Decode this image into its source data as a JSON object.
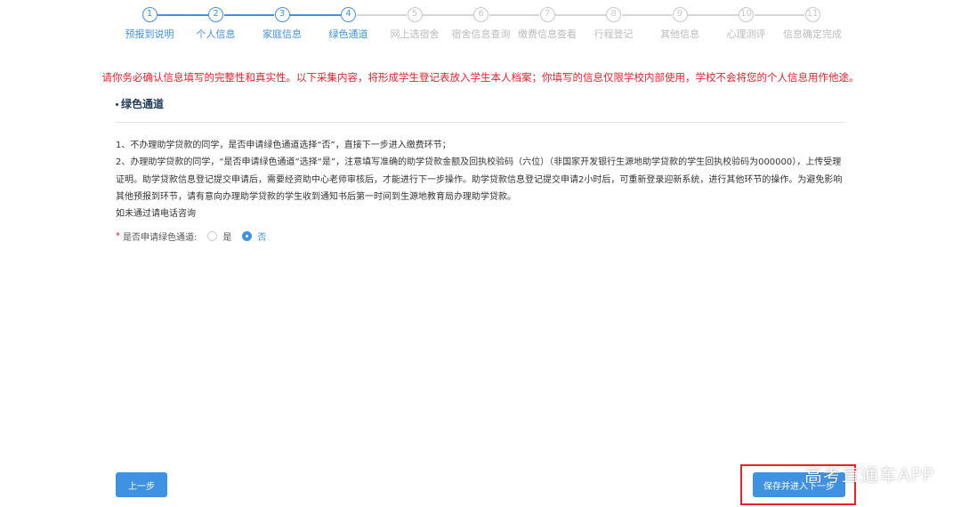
{
  "steps": [
    {
      "num": "1",
      "label": "预报到说明",
      "done": true
    },
    {
      "num": "2",
      "label": "个人信息",
      "done": true
    },
    {
      "num": "3",
      "label": "家庭信息",
      "done": true
    },
    {
      "num": "4",
      "label": "绿色通道",
      "done": true
    },
    {
      "num": "5",
      "label": "网上选宿舍",
      "done": false
    },
    {
      "num": "6",
      "label": "宿舍信息查询",
      "done": false
    },
    {
      "num": "7",
      "label": "缴费信息查看",
      "done": false
    },
    {
      "num": "8",
      "label": "行程登记",
      "done": false
    },
    {
      "num": "9",
      "label": "其他信息",
      "done": false
    },
    {
      "num": "10",
      "label": "心理测评",
      "done": false
    },
    {
      "num": "11",
      "label": "信息确定完成",
      "done": false
    }
  ],
  "warning": "请你务必确认信息填写的完整性和真实性。以下采集内容，将形成学生登记表放入学生本人档案；你填写的信息仅限学校内部使用，学校不会将您的个人信息用作他途。",
  "section_title": "绿色通道",
  "notes": {
    "line1": "1、不办理助学贷款的同学，是否申请绿色通道选择“否”，直接下一步进入缴费环节；",
    "line2": "2、办理助学贷款的同学，“是否申请绿色通道”选择“是”，注意填写准确的助学贷款金额及回执校验码（六位）（非国家开发银行生源地助学贷款的学生回执校验码为000000），上传受理证明。助学贷款信息登记提交申请后，需要经资助中心老师审核后，才能进行下一步操作。助学贷款信息登记提交申请2小时后，可重新登录迎新系统，进行其他环节的操作。为避免影响其他预报到环节，请有意向办理助学贷款的学生收到通知书后第一时间到生源地教育局办理助学贷款。",
    "line3": "如未通过请电话咨询"
  },
  "form": {
    "required_mark": "*",
    "label": "是否申请绿色通道:",
    "option_yes": "是",
    "option_no": "否",
    "selected": "否"
  },
  "buttons": {
    "prev": "上一步",
    "next": "保存并进入下一步"
  },
  "watermark": "高考直通车APP",
  "colors": {
    "accent": "#3f92e2",
    "warning": "#e8212d",
    "inactive": "#c8c8c8"
  }
}
